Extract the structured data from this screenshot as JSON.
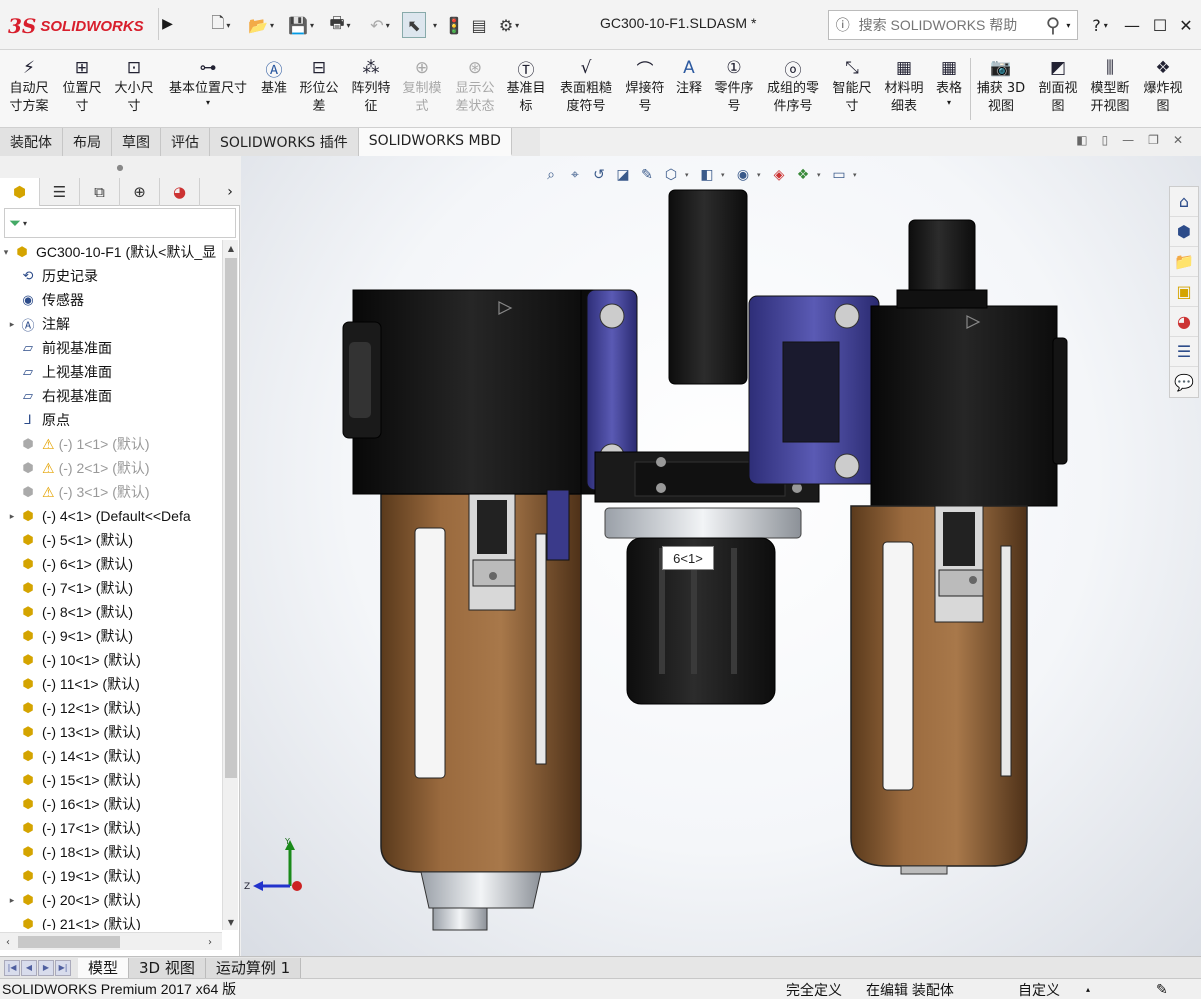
{
  "app": {
    "logo_mark": "3S",
    "logo_text": "SOLIDWORKS",
    "doc_title": "GC300-10-F1.SLDASM *"
  },
  "search": {
    "placeholder": "搜索 SOLIDWORKS 帮助"
  },
  "help": {
    "question_label": "?"
  },
  "command_manager": {
    "items": [
      {
        "label": "自动尺\n寸方案",
        "icon": "auto-dimension-icon",
        "disabled": false
      },
      {
        "label": "位置尺\n寸",
        "icon": "location-dimension-icon",
        "disabled": false
      },
      {
        "label": "大小尺\n寸",
        "icon": "size-dimension-icon",
        "disabled": false
      },
      {
        "label": "基本位置尺寸",
        "icon": "basic-location-dimension-icon",
        "disabled": false
      },
      {
        "label": "基准",
        "icon": "datum-icon",
        "disabled": false
      },
      {
        "label": "形位公\n差",
        "icon": "geometric-tolerance-icon",
        "disabled": false
      },
      {
        "label": "阵列特\n征",
        "icon": "pattern-feature-icon",
        "disabled": false
      },
      {
        "label": "复制模\n式",
        "icon": "copy-scheme-icon",
        "disabled": true
      },
      {
        "label": "显示公\n差状态",
        "icon": "tolerance-status-icon",
        "disabled": true
      },
      {
        "label": "基准目\n标",
        "icon": "datum-target-icon",
        "disabled": false
      },
      {
        "label": "表面粗糙\n度符号",
        "icon": "surface-finish-icon",
        "disabled": false
      },
      {
        "label": "焊接符\n号",
        "icon": "weld-symbol-icon",
        "disabled": false
      },
      {
        "label": "注释",
        "icon": "note-icon",
        "disabled": false
      },
      {
        "label": "零件序\n号",
        "icon": "balloon-icon",
        "disabled": false
      },
      {
        "label": "成组的零\n件序号",
        "icon": "stacked-balloon-icon",
        "disabled": false
      },
      {
        "label": "智能尺\n寸",
        "icon": "smart-dimension-icon",
        "disabled": false
      },
      {
        "label": "材料明\n细表",
        "icon": "bill-of-materials-icon",
        "disabled": false
      },
      {
        "label": "表格",
        "icon": "table-icon",
        "disabled": false
      },
      {
        "label": "捕获 3D\n视图",
        "icon": "capture-3d-view-icon",
        "disabled": false
      },
      {
        "label": "剖面视\n图",
        "icon": "section-view-icon",
        "disabled": false
      },
      {
        "label": "模型断\n开视图",
        "icon": "model-break-view-icon",
        "disabled": false
      },
      {
        "label": "爆炸视\n图",
        "icon": "exploded-view-icon",
        "disabled": false
      }
    ]
  },
  "tabs": [
    {
      "label": "装配体",
      "active": false
    },
    {
      "label": "布局",
      "active": false
    },
    {
      "label": "草图",
      "active": false
    },
    {
      "label": "评估",
      "active": false
    },
    {
      "label": "SOLIDWORKS 插件",
      "active": false
    },
    {
      "label": "SOLIDWORKS MBD",
      "active": true
    }
  ],
  "tree": {
    "items": [
      {
        "label": "GC300-10-F1  (默认<默认_显",
        "icon": "assembly-icon",
        "expand": "▾",
        "dim": false,
        "warn": false,
        "indent": 0
      },
      {
        "label": "历史记录",
        "icon": "history-icon",
        "expand": "",
        "dim": false,
        "warn": false,
        "indent": 1
      },
      {
        "label": "传感器",
        "icon": "sensor-icon",
        "expand": "",
        "dim": false,
        "warn": false,
        "indent": 1
      },
      {
        "label": "注解",
        "icon": "annotations-icon",
        "expand": "▸",
        "dim": false,
        "warn": false,
        "indent": 1
      },
      {
        "label": "前视基准面",
        "icon": "plane-icon",
        "expand": "",
        "dim": false,
        "warn": false,
        "indent": 1
      },
      {
        "label": "上视基准面",
        "icon": "plane-icon",
        "expand": "",
        "dim": false,
        "warn": false,
        "indent": 1
      },
      {
        "label": "右视基准面",
        "icon": "plane-icon",
        "expand": "",
        "dim": false,
        "warn": false,
        "indent": 1
      },
      {
        "label": "原点",
        "icon": "origin-icon",
        "expand": "",
        "dim": false,
        "warn": false,
        "indent": 1
      },
      {
        "label": "(-) 1<1> (默认)",
        "icon": "part-suppressed-icon",
        "expand": "",
        "dim": true,
        "warn": true,
        "indent": 1
      },
      {
        "label": "(-) 2<1> (默认)",
        "icon": "part-suppressed-icon",
        "expand": "",
        "dim": true,
        "warn": true,
        "indent": 1
      },
      {
        "label": "(-) 3<1> (默认)",
        "icon": "part-suppressed-icon",
        "expand": "",
        "dim": true,
        "warn": true,
        "indent": 1
      },
      {
        "label": "(-) 4<1> (Default<<Defa",
        "icon": "subassembly-icon",
        "expand": "▸",
        "dim": false,
        "warn": false,
        "indent": 1
      },
      {
        "label": "(-) 5<1> (默认)",
        "icon": "part-icon",
        "expand": "",
        "dim": false,
        "warn": false,
        "indent": 1
      },
      {
        "label": "(-) 6<1> (默认)",
        "icon": "part-icon",
        "expand": "",
        "dim": false,
        "warn": false,
        "indent": 1
      },
      {
        "label": "(-) 7<1> (默认)",
        "icon": "part-icon",
        "expand": "",
        "dim": false,
        "warn": false,
        "indent": 1
      },
      {
        "label": "(-) 8<1> (默认)",
        "icon": "part-icon",
        "expand": "",
        "dim": false,
        "warn": false,
        "indent": 1
      },
      {
        "label": "(-) 9<1> (默认)",
        "icon": "part-icon",
        "expand": "",
        "dim": false,
        "warn": false,
        "indent": 1
      },
      {
        "label": "(-) 10<1> (默认)",
        "icon": "part-icon",
        "expand": "",
        "dim": false,
        "warn": false,
        "indent": 1
      },
      {
        "label": "(-) 11<1> (默认)",
        "icon": "part-icon",
        "expand": "",
        "dim": false,
        "warn": false,
        "indent": 1
      },
      {
        "label": "(-) 12<1> (默认)",
        "icon": "part-icon",
        "expand": "",
        "dim": false,
        "warn": false,
        "indent": 1
      },
      {
        "label": "(-) 13<1> (默认)",
        "icon": "part-icon",
        "expand": "",
        "dim": false,
        "warn": false,
        "indent": 1
      },
      {
        "label": "(-) 14<1> (默认)",
        "icon": "part-icon",
        "expand": "",
        "dim": false,
        "warn": false,
        "indent": 1
      },
      {
        "label": "(-) 15<1> (默认)",
        "icon": "part-icon",
        "expand": "",
        "dim": false,
        "warn": false,
        "indent": 1
      },
      {
        "label": "(-) 16<1> (默认)",
        "icon": "part-icon",
        "expand": "",
        "dim": false,
        "warn": false,
        "indent": 1
      },
      {
        "label": "(-) 17<1> (默认)",
        "icon": "part-icon",
        "expand": "",
        "dim": false,
        "warn": false,
        "indent": 1
      },
      {
        "label": "(-) 18<1> (默认)",
        "icon": "part-icon",
        "expand": "",
        "dim": false,
        "warn": false,
        "indent": 1
      },
      {
        "label": "(-) 19<1> (默认)",
        "icon": "part-icon",
        "expand": "",
        "dim": false,
        "warn": false,
        "indent": 1
      },
      {
        "label": "(-) 20<1> (默认)",
        "icon": "subassembly-icon",
        "expand": "▸",
        "dim": false,
        "warn": false,
        "indent": 1
      },
      {
        "label": "(-) 21<1> (默认)",
        "icon": "part-icon",
        "expand": "",
        "dim": false,
        "warn": false,
        "indent": 1
      }
    ]
  },
  "viewport": {
    "callout_label": "6<1>",
    "triad": {
      "x_label": "Z",
      "y_label": "Y"
    }
  },
  "model_tabs": [
    {
      "label": "模型",
      "active": true
    },
    {
      "label": "3D 视图",
      "active": false
    },
    {
      "label": "运动算例 1",
      "active": false
    }
  ],
  "status": {
    "product": "SOLIDWORKS Premium 2017 x64 版",
    "definition": "完全定义",
    "editing": "在编辑 装配体",
    "units": "自定义"
  },
  "colors": {
    "brand": "#d81e2c",
    "bowl": "#8a5a2e",
    "bracket": "#4a4a9e",
    "body": "#151515"
  }
}
